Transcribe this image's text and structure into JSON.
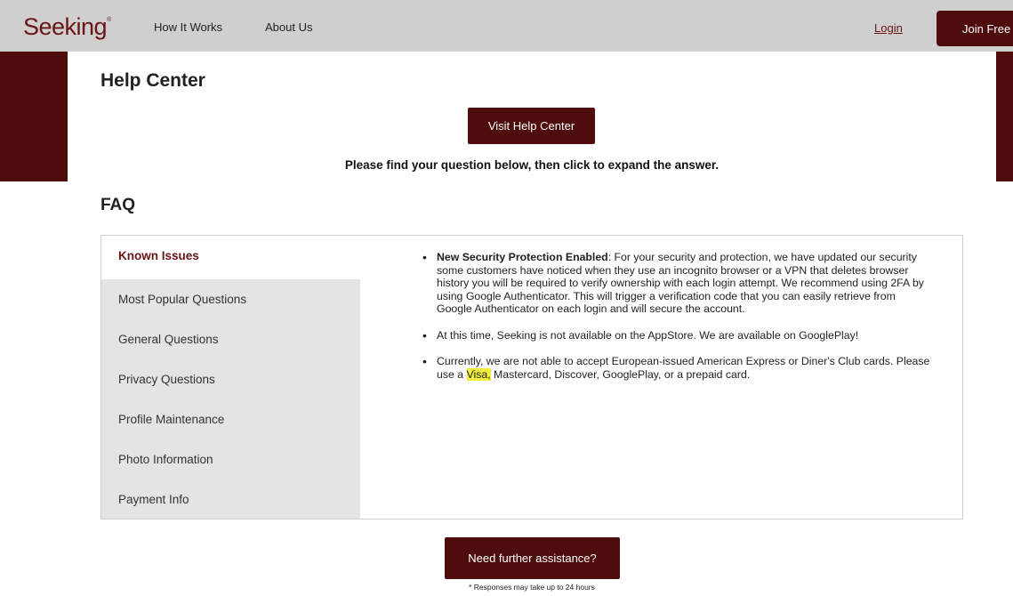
{
  "header": {
    "logo": "Seeking",
    "logo_mark": "®",
    "nav": [
      "How It Works",
      "About Us"
    ],
    "login": "Login",
    "join": "Join Free"
  },
  "help": {
    "title": "Help Center",
    "visit_button": "Visit Help Center",
    "instruction": "Please find your question below, then click to expand the answer."
  },
  "faq": {
    "title": "FAQ",
    "categories": [
      "Known Issues",
      "Most Popular Questions",
      "General Questions",
      "Privacy Questions",
      "Profile Maintenance",
      "Photo Information",
      "Payment Info"
    ],
    "active_index": 0,
    "items": [
      {
        "heading": "New Security Protection Enabled",
        "text": ": For your security and protection, we have updated our security some customers have noticed when they use an incognito browser or a VPN that deletes browser history you will be required to verify ownership with each login attempt. We recommend using 2FA by using Google Authenticator. This will trigger a verification code that you can easily retrieve from Google Authenticator on each login and will secure the account."
      },
      {
        "text": "At this time, Seeking is not available on the AppStore. We are available on GooglePlay!"
      },
      {
        "text_before": "Currently, we are not able to accept European-issued American Express or Diner's Club cards. Please use a ",
        "highlight": "Visa,",
        "text_after": " Mastercard, Discover, GooglePlay, or a prepaid card."
      }
    ]
  },
  "footer": {
    "assist_button": "Need further assistance?",
    "note": "* Responses may take up to 24 hours"
  },
  "colors": {
    "brand": "#4f0c0c",
    "header_bg": "#cfcfcf",
    "sidebar_bg": "#e4e4e4",
    "highlight": "#f2ee3a"
  }
}
